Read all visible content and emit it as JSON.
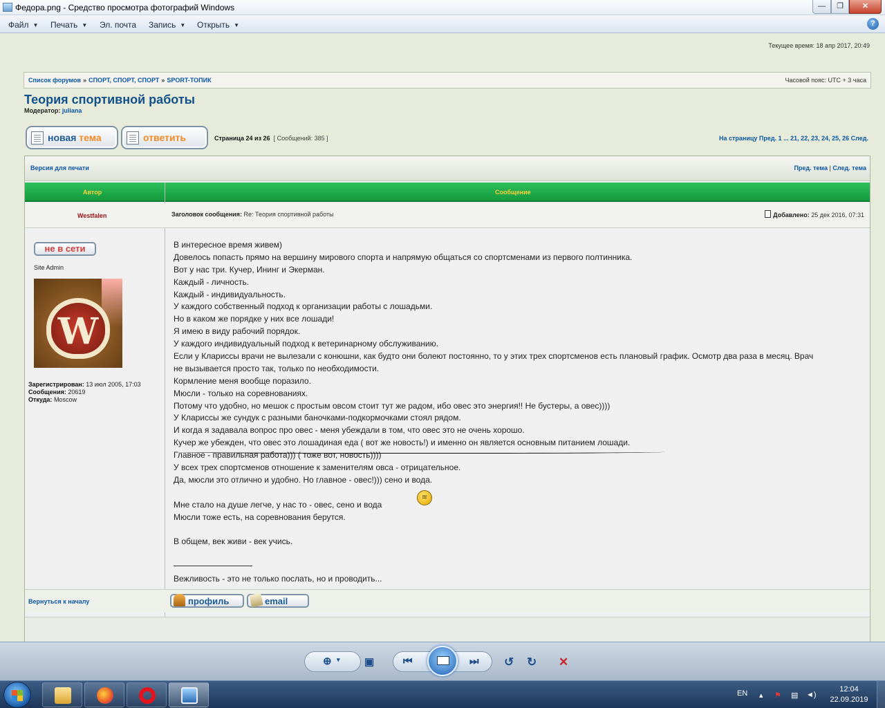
{
  "window": {
    "title": "Федора.png - Средство просмотра фотографий Windows"
  },
  "menu": {
    "items": [
      {
        "label": "Файл",
        "has_arrow": true
      },
      {
        "label": "Печать",
        "has_arrow": true
      },
      {
        "label": "Эл. почта",
        "has_arrow": false
      },
      {
        "label": "Запись",
        "has_arrow": true
      },
      {
        "label": "Открыть",
        "has_arrow": true
      }
    ],
    "help_label": "?"
  },
  "forum": {
    "current_time": "Текущее время: 18 апр 2017, 20:49",
    "breadcrumb": [
      "Список форумов",
      "СПОРТ, СПОРТ, СПОРТ",
      "SPORT-ТОПИК"
    ],
    "breadcrumb_sep": "»",
    "timezone": "Часовой пояс: UTC + 3 часа",
    "topic_title": "Теория спортивной работы",
    "moderator_label": "Модератор:",
    "moderator_name": "juliana",
    "new_topic_word1": "новая",
    "new_topic_word2": "тема",
    "reply_label": "ответить",
    "page_label": "Страница 24 из 26",
    "posts_count": "[ Сообщений: 385 ]",
    "pagination": "На страницу Пред.  1  ... 21, 22, 23, 24, 25, 26  След.",
    "print_version": "Версия для печати",
    "prev_topic": "Пред. тема",
    "nav_sep": "|",
    "next_topic": "След. тема",
    "col_author": "Автор",
    "col_message": "Сообщение",
    "post": {
      "author": "Westfalen",
      "subject_label": "Заголовок сообщения:",
      "subject": "Re: Теория спортивной работы",
      "added_label": "Добавлено:",
      "added": "25 дек 2016, 07:31",
      "status": "не в сети",
      "rank": "Site Admin",
      "avatar_letter": "W",
      "registered_label": "Зарегистрирован:",
      "registered": "13 июл 2005, 17:03",
      "posts_label": "Сообщения:",
      "posts": "20619",
      "from_label": "Откуда:",
      "from": "Moscow",
      "lines": [
        "В интересное время живем)",
        "Довелось попасть прямо на вершину мирового спорта и напрямую общаться со спортсменами из первого полтинника.",
        "Вот у нас три. Кучер, Ининг и Экерман.",
        "Каждый - личность.",
        "Каждый - индивидуальность.",
        "У каждого собственный подход к организации работы с лошадьми.",
        "Но в каком же порядке у них все лошади!",
        "Я имею в виду рабочий порядок.",
        "У каждого индивидуальный подход к ветеринарному обслуживанию.",
        "Если у Кларисcы врачи не вылезали с конюшни, как будто они болеют постоянно, то у этих трех спортсменов есть плановый график. Осмотр два раза в месяц. Врач",
        "не вызывается просто так, только по необходимости.",
        "Кормление меня вообще поразило.",
        "Мюсли - только на соревнованиях.",
        "Потому что удобно, но мешок с простым овсом стоит тут же радом, ибо овес это энергия!! Не бустеры, а овес))))",
        "У Кларисcы же сундук с разными баночками-подкормочками стоял рядом.",
        "И когда я задавала вопрос про овес - меня убеждали в том, что овес это не очень хорошо.",
        "Кучер же убежден, что овес это лошадиная еда ( вот же новость!) и именно он является основным питанием лошади.",
        "Главное - правильная работа))) ( тоже вот, новость))))",
        "У всех трех спортсменов отношение к заменителям овса - отрицательное.",
        "Да, мюсли это отлично и удобно. Но главное - овес!))) сено и вода.",
        "",
        "Мне стало на душе легче, у нас то - овес, сено и вода",
        "Мюсли тоже есть, на соревнования берутся.",
        "",
        "В общем, век живи - век учись.",
        "",
        "",
        "Вежливость - это не только послать, но и проводить..."
      ]
    },
    "back_to_top": "Вернуться к началу",
    "profile_button": "профиль",
    "email_button": "email"
  },
  "taskbar": {
    "language": "EN",
    "time": "12:04",
    "date": "22.09.2019"
  }
}
